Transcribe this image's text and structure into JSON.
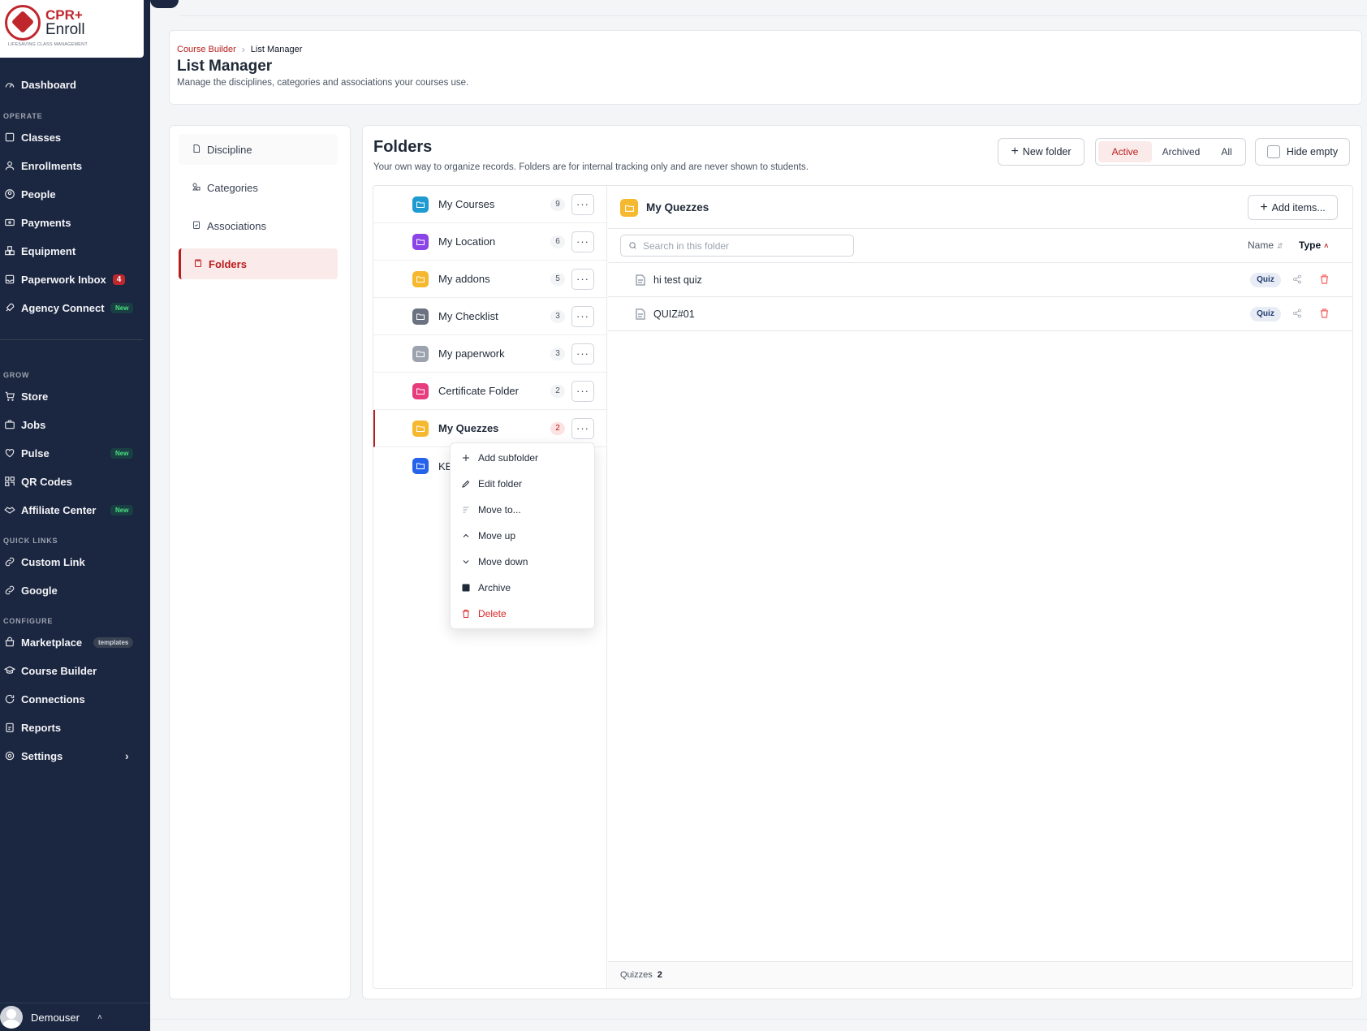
{
  "brand": {
    "line1": "CPR+",
    "line2": "Enroll",
    "tagline": "LIFESAVING CLASS MANAGEMENT"
  },
  "sidebar": {
    "top": [
      {
        "label": "Dashboard"
      }
    ],
    "operate_head": "OPERATE",
    "operate": [
      {
        "label": "Classes"
      },
      {
        "label": "Enrollments"
      },
      {
        "label": "People"
      },
      {
        "label": "Payments"
      },
      {
        "label": "Equipment"
      },
      {
        "label": "Paperwork Inbox",
        "badge": "4"
      },
      {
        "label": "Agency Connect",
        "badge": "New"
      }
    ],
    "grow_head": "GROW",
    "grow": [
      {
        "label": "Store"
      },
      {
        "label": "Jobs"
      },
      {
        "label": "Pulse",
        "badge": "New"
      },
      {
        "label": "QR Codes"
      },
      {
        "label": "Affiliate Center",
        "badge": "New"
      }
    ],
    "quick_head": "QUICK LINKS",
    "quick": [
      {
        "label": "Custom Link"
      },
      {
        "label": "Google"
      }
    ],
    "configure_head": "CONFIGURE",
    "configure": [
      {
        "label": "Marketplace",
        "badge": "templates"
      },
      {
        "label": "Course Builder"
      },
      {
        "label": "Connections"
      },
      {
        "label": "Reports"
      },
      {
        "label": "Settings"
      }
    ],
    "user": "Demouser"
  },
  "header": {
    "crumb_parent": "Course Builder",
    "crumb_current": "List Manager",
    "title": "List Manager",
    "subtitle": "Manage the disciplines, categories and associations your courses use."
  },
  "tabs": [
    {
      "label": "Discipline"
    },
    {
      "label": "Categories"
    },
    {
      "label": "Associations"
    },
    {
      "label": "Folders"
    }
  ],
  "folders": {
    "title": "Folders",
    "subtitle": "Your own way to organize records. Folders are for internal tracking only and are never shown to students.",
    "new_folder": "New folder",
    "filters": {
      "active": "Active",
      "archived": "Archived",
      "all": "All"
    },
    "hide_empty": "Hide empty",
    "list": [
      {
        "name": "My Courses",
        "count": "9",
        "color": "#1e9bd0"
      },
      {
        "name": "My Location",
        "count": "6",
        "color": "#8b45e6"
      },
      {
        "name": "My addons",
        "count": "5",
        "color": "#f5b82e"
      },
      {
        "name": "My Checklist",
        "count": "3",
        "color": "#6b7280"
      },
      {
        "name": "My paperwork",
        "count": "3",
        "color": "#9ca3af"
      },
      {
        "name": "Certificate Folder",
        "count": "2",
        "color": "#e73c7e"
      },
      {
        "name": "My Quezzes",
        "count": "2",
        "color": "#f5b82e"
      },
      {
        "name": "KE",
        "count": "",
        "color": "#2563eb"
      }
    ]
  },
  "detail": {
    "title": "My Quezzes",
    "add_items": "Add items...",
    "search_placeholder": "Search in this folder",
    "sort_name": "Name",
    "sort_type": "Type",
    "items": [
      {
        "name": "hi test quiz",
        "type": "Quiz"
      },
      {
        "name": "QUIZ#01",
        "type": "Quiz"
      }
    ],
    "footer_label": "Quizzes",
    "footer_count": "2"
  },
  "menu": [
    {
      "label": "Add subfolder",
      "icon": "plus-icon"
    },
    {
      "label": "Edit folder",
      "icon": "pencil-icon"
    },
    {
      "label": "Move to...",
      "icon": "move-icon"
    },
    {
      "label": "Move up",
      "icon": "chevron-up-icon"
    },
    {
      "label": "Move down",
      "icon": "chevron-down-icon"
    },
    {
      "label": "Archive",
      "icon": "archive-icon"
    },
    {
      "label": "Delete",
      "icon": "trash-icon"
    }
  ],
  "colors": {
    "brand": "#c0272d",
    "sidebar": "#1b2641",
    "accent": "#b91c1c"
  }
}
